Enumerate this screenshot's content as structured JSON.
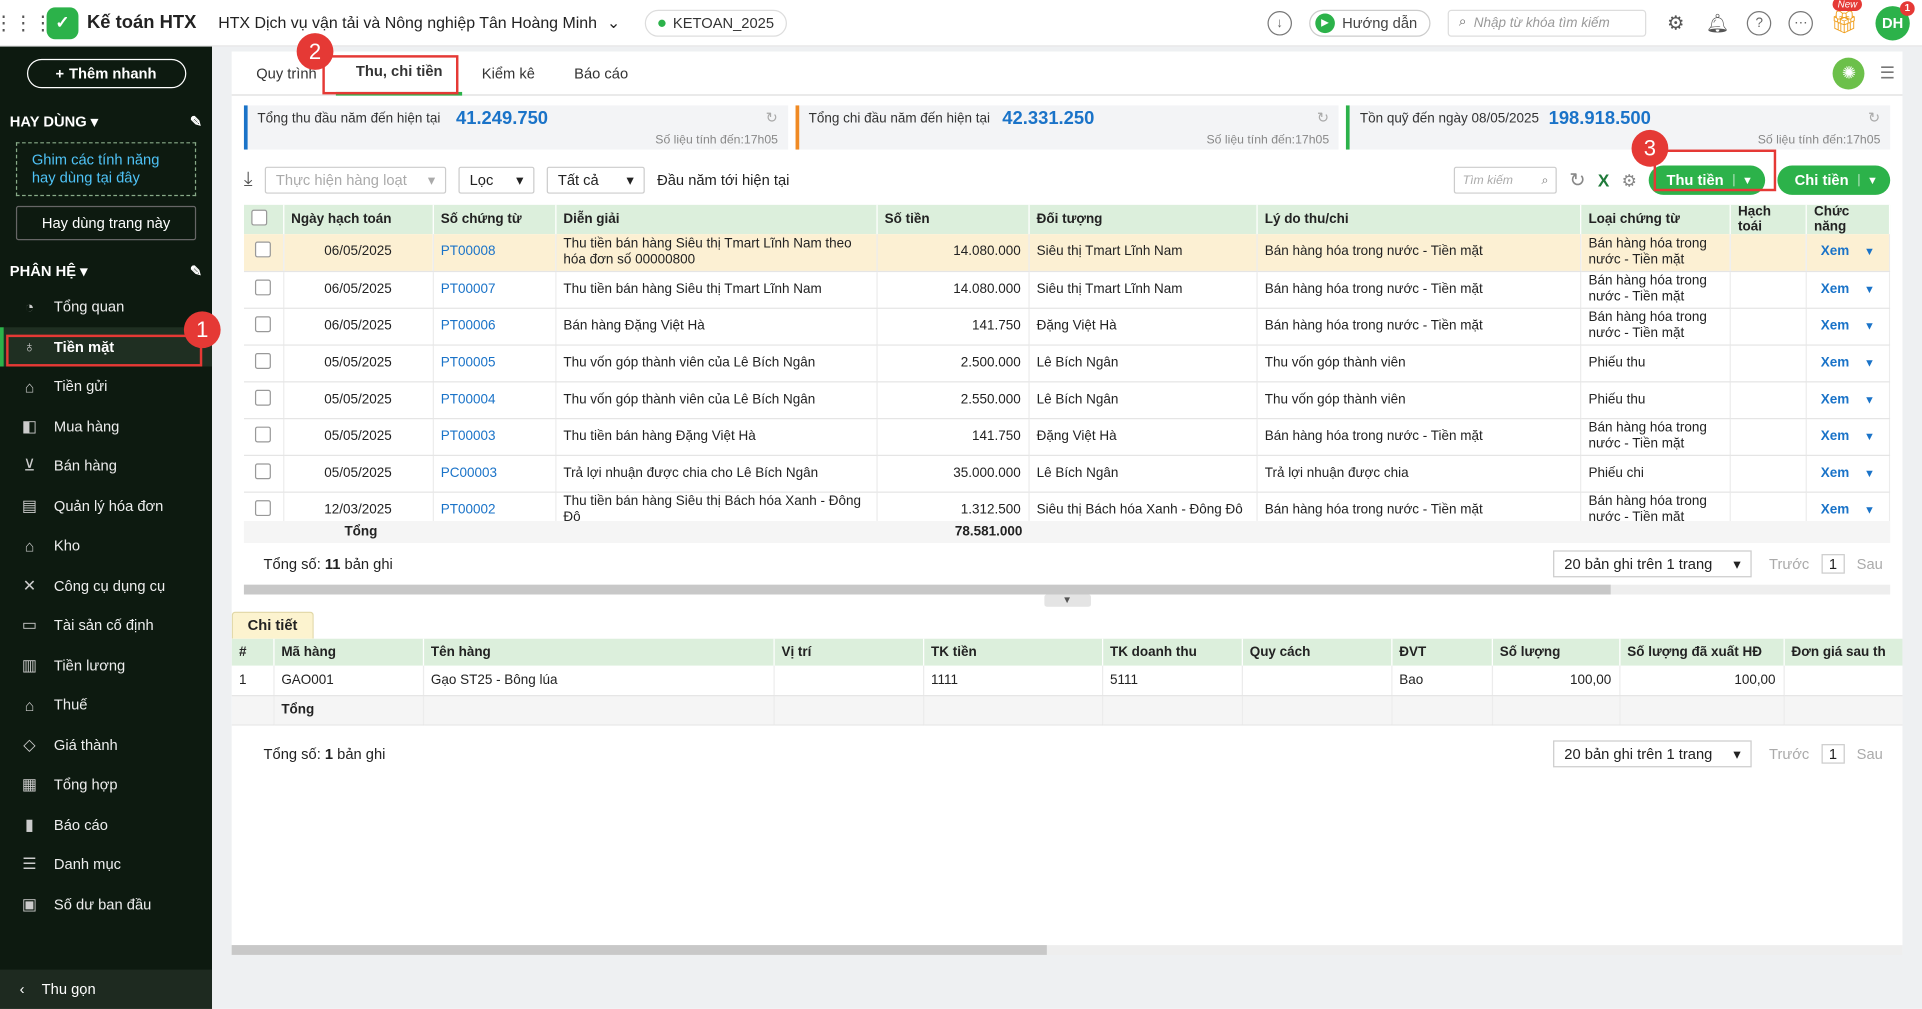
{
  "app": {
    "logo_text": "Kế toán HTX",
    "org_name": "HTX Dịch vụ vận tải và Nông nghiệp Tân Hoàng Minh",
    "db_name": "KETOAN_2025",
    "guide_label": "Hướng dẫn",
    "search_placeholder": "Nhập từ khóa tìm kiếm",
    "new_badge": "New",
    "avatar_initials": "DH",
    "avatar_badge": "1"
  },
  "sidebar": {
    "add_quick": "Thêm nhanh",
    "favorites_title": "HAY DÙNG",
    "pin_hint": "Ghim các tính năng hay dùng tại đây",
    "pin_button": "Hay dùng trang này",
    "modules_title": "PHÂN HỆ",
    "items": [
      {
        "label": "Tổng quan",
        "icon": "dashboard-icon"
      },
      {
        "label": "Tiền mặt",
        "icon": "money-bag-icon"
      },
      {
        "label": "Tiền gửi",
        "icon": "bank-icon"
      },
      {
        "label": "Mua hàng",
        "icon": "shopping-bag-icon"
      },
      {
        "label": "Bán hàng",
        "icon": "cart-icon"
      },
      {
        "label": "Quản lý hóa đơn",
        "icon": "invoice-icon"
      },
      {
        "label": "Kho",
        "icon": "warehouse-icon"
      },
      {
        "label": "Công cụ dụng cụ",
        "icon": "tools-icon"
      },
      {
        "label": "Tài sản cố định",
        "icon": "car-icon"
      },
      {
        "label": "Tiền lương",
        "icon": "payroll-icon"
      },
      {
        "label": "Thuế",
        "icon": "tax-icon"
      },
      {
        "label": "Giá thành",
        "icon": "price-tag-icon"
      },
      {
        "label": "Tổng hợp",
        "icon": "ledger-icon"
      },
      {
        "label": "Báo cáo",
        "icon": "report-icon"
      },
      {
        "label": "Danh mục",
        "icon": "list-icon"
      },
      {
        "label": "Số dư ban đầu",
        "icon": "balance-icon"
      }
    ],
    "collapse_label": "Thu gọn"
  },
  "tabs": [
    "Quy trình",
    "Thu, chi tiền",
    "Kiểm kê",
    "Báo cáo"
  ],
  "stats": [
    {
      "label": "Tổng thu đầu năm đến hiện tại",
      "value": "41.249.750",
      "note": "Số liệu tính đến:17h05",
      "color": "#1a73c8"
    },
    {
      "label": "Tổng chi đầu năm đến hiện tại",
      "value": "42.331.250",
      "note": "Số liệu tính đến:17h05",
      "color": "#f08a24"
    },
    {
      "label": "Tồn quỹ đến ngày 08/05/2025",
      "value": "198.918.500",
      "note": "Số liệu tính đến:17h05",
      "color": "#2cb24a"
    }
  ],
  "toolbar": {
    "bulk_action": "Thực hiện hàng loạt",
    "filter": "Lọc",
    "type_filter": "Tất cả",
    "period": "Đầu năm tới hiện tại",
    "search_placeholder": "Tìm kiếm",
    "receive_button": "Thu tiền",
    "pay_button": "Chi tiền"
  },
  "main_table": {
    "headers": [
      "Ngày hạch toán",
      "Số chứng từ",
      "Diễn giải",
      "Số tiền",
      "Đối tượng",
      "Lý do thu/chi",
      "Loại chứng từ",
      "Hạch toái",
      "Chức năng"
    ],
    "rows": [
      {
        "date": "06/05/2025",
        "doc": "PT00008",
        "desc": "Thu tiền bán hàng Siêu thị Tmart Lĩnh Nam theo hóa đơn số 00000800",
        "amount": "14.080.000",
        "obj": "Siêu thị Tmart Lĩnh Nam",
        "reason": "Bán hàng hóa trong nước - Tiền mặt",
        "type": "Bán hàng hóa trong nước - Tiền mặt",
        "action": "Xem"
      },
      {
        "date": "06/05/2025",
        "doc": "PT00007",
        "desc": "Thu tiền bán hàng Siêu thị Tmart Lĩnh Nam",
        "amount": "14.080.000",
        "obj": "Siêu thị Tmart Lĩnh Nam",
        "reason": "Bán hàng hóa trong nước - Tiền mặt",
        "type": "Bán hàng hóa trong nước - Tiền mặt",
        "action": "Xem"
      },
      {
        "date": "06/05/2025",
        "doc": "PT00006",
        "desc": "Bán hàng Đặng Việt Hà",
        "amount": "141.750",
        "obj": "Đặng Việt Hà",
        "reason": "Bán hàng hóa trong nước - Tiền mặt",
        "type": "Bán hàng hóa trong nước - Tiền mặt",
        "action": "Xem"
      },
      {
        "date": "05/05/2025",
        "doc": "PT00005",
        "desc": "Thu vốn góp thành viên của Lê Bích Ngân",
        "amount": "2.500.000",
        "obj": "Lê Bích Ngân",
        "reason": "Thu vốn góp thành viên",
        "type": "Phiếu thu",
        "action": "Xem"
      },
      {
        "date": "05/05/2025",
        "doc": "PT00004",
        "desc": "Thu vốn góp thành viên của Lê Bích Ngân",
        "amount": "2.550.000",
        "obj": "Lê Bích Ngân",
        "reason": "Thu vốn góp thành viên",
        "type": "Phiếu thu",
        "action": "Xem"
      },
      {
        "date": "05/05/2025",
        "doc": "PT00003",
        "desc": "Thu tiền bán hàng Đặng Việt Hà",
        "amount": "141.750",
        "obj": "Đặng Việt Hà",
        "reason": "Bán hàng hóa trong nước - Tiền mặt",
        "type": "Bán hàng hóa trong nước - Tiền mặt",
        "action": "Xem"
      },
      {
        "date": "05/05/2025",
        "doc": "PC00003",
        "desc": "Trả lợi nhuận được chia cho Lê Bích Ngân",
        "amount": "35.000.000",
        "obj": "Lê Bích Ngân",
        "reason": "Trả lợi nhuận được chia",
        "type": "Phiếu chi",
        "action": "Xem"
      },
      {
        "date": "12/03/2025",
        "doc": "PT00002",
        "desc": "Thu tiền bán hàng Siêu thị Bách hóa Xanh - Đông Đô",
        "amount": "1.312.500",
        "obj": "Siêu thị Bách hóa Xanh - Đông Đô",
        "reason": "Bán hàng hóa trong nước - Tiền mặt",
        "type": "Bán hàng hóa trong nước - Tiền mặt",
        "action": "Xem"
      }
    ],
    "total_label": "Tổng",
    "total_amount": "78.581.000",
    "count_prefix": "Tổng số: ",
    "count": "11",
    "count_suffix": " bản ghi",
    "page_size": "20 bản ghi trên 1 trang",
    "prev": "Trước",
    "page": "1",
    "next": "Sau"
  },
  "detail": {
    "tab": "Chi tiết",
    "headers": [
      "#",
      "Mã hàng",
      "Tên hàng",
      "Vị trí",
      "TK tiền",
      "TK doanh thu",
      "Quy cách",
      "ĐVT",
      "Số lượng",
      "Số lượng đã xuất HĐ",
      "Đơn giá sau th"
    ],
    "rows": [
      {
        "no": "1",
        "code": "GAO001",
        "name": "Gạo ST25 - Bông lúa",
        "loc": "",
        "acc_cash": "1111",
        "acc_rev": "5111",
        "spec": "",
        "unit": "Bao",
        "qty": "100,00",
        "qty_inv": "100,00",
        "price": ""
      }
    ],
    "total_label": "Tổng",
    "count_prefix": "Tổng số: ",
    "count": "1",
    "count_suffix": " bản ghi",
    "page_size": "20 bản ghi trên 1 trang",
    "prev": "Trước",
    "page": "1",
    "next": "Sau"
  },
  "callouts": [
    "1",
    "2",
    "3"
  ]
}
